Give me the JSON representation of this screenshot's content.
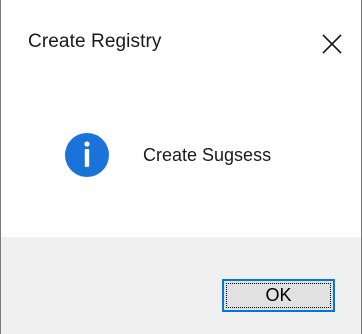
{
  "dialog": {
    "title": "Create Registry",
    "close_glyph": "✕",
    "message": "Create Sugsess",
    "icon": "info-icon",
    "ok_label": "OK"
  },
  "colors": {
    "info_icon_fill": "#1a73d9",
    "button_border": "#0078d7",
    "footer_bg": "#f0f0f0"
  }
}
